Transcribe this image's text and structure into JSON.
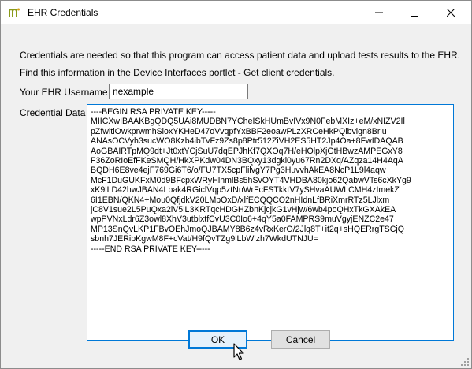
{
  "window": {
    "title": "EHR Credentials",
    "controls": [
      "minimize",
      "maximize",
      "close"
    ]
  },
  "info": {
    "line1": "Credentials are needed so that this program can  access patient data and upload tests results to the EHR.",
    "line2": "Find this information in the Device Interfaces portlet - Get client credentials."
  },
  "username": {
    "label": "Your EHR Username",
    "value": "nexample"
  },
  "credential": {
    "label": "Credential Data",
    "value": "----BEGIN RSA PRIVATE KEY-----\nMIICXwIBAAKBgQDQ5UAi8MUDBN7YCheISkHUmBvIVx9N0FebMXIz+eM/xNIZV2Il\npZfwltlOwkprwmhSloxYKHeD47oVvqpfYxBBF2eoawPLzXRCeHkPQlbvign8Brlu\nANAsOCVyh3sucWO8Kzb4ibTvFz9Zs8p8Ptr512ZiVH2ES5HT2Jp4Oa+8FwIDAQAB\nAoGBAIRTpMQ9dt+Jt0xtYCjSuU7dqEPJhKf7QXOq7H/eHOlpXjGtHBwzAMPEGxY8\nF36ZoRIoEfFKeSMQH/HkXPKdw04DN3BQxy13dgkl0yu67Rn2DXq/AZqza14H4AqA\nBQDH6E8ve4ejF769Gi6T6/o/FU7TX5cpFlilvgY7Pg3HuvvhAkEA8NcP1L9l4aqw\nMcF1DuGUKFxM0d9BFcpxWRyHlhmlBs5hSvOYT4VHDBA80kjo62QabwVTs6cXkYg9\nxK9lLD42hwJBAN4Lbak4RGiclVqp5ztNnWrFcFSTkktV7ySHvaAUWLCMH4zImekZ\n6I1EBN/QKN4+Mou0QfjdkV20LMpOxD/xlfECQQCO2nHIdnLfBRiXmrRTz5LJlxm\njC8V1sue2L5PuQxa2iV5iL3KRTqcHDGHZbnKjcjkG1vHjw/6wb4poQHxTkGXAkEA\nwpPVNxLdr6Z3owl8XhV3utblxtfCvU3C0Io6+4qY5a0FAMPRS9muVgyjENZC2e47\nMP13SnQvLKP1FBvOEhJmoQJBAMY8B6z4vRxKerO/2Jlq8T+it2q+sHQERrgTSCjQ\nsbnh7JERibKgwM8F+cVat/H9fQvTZg9lLbWlzh7WkdUTNJU=\n-----END RSA PRIVATE KEY-----"
  },
  "buttons": {
    "ok": "OK",
    "cancel": "Cancel"
  },
  "colors": {
    "focus": "#0078d7",
    "window_bg": "#f0f0f0",
    "logo": "#8a9a1a"
  }
}
